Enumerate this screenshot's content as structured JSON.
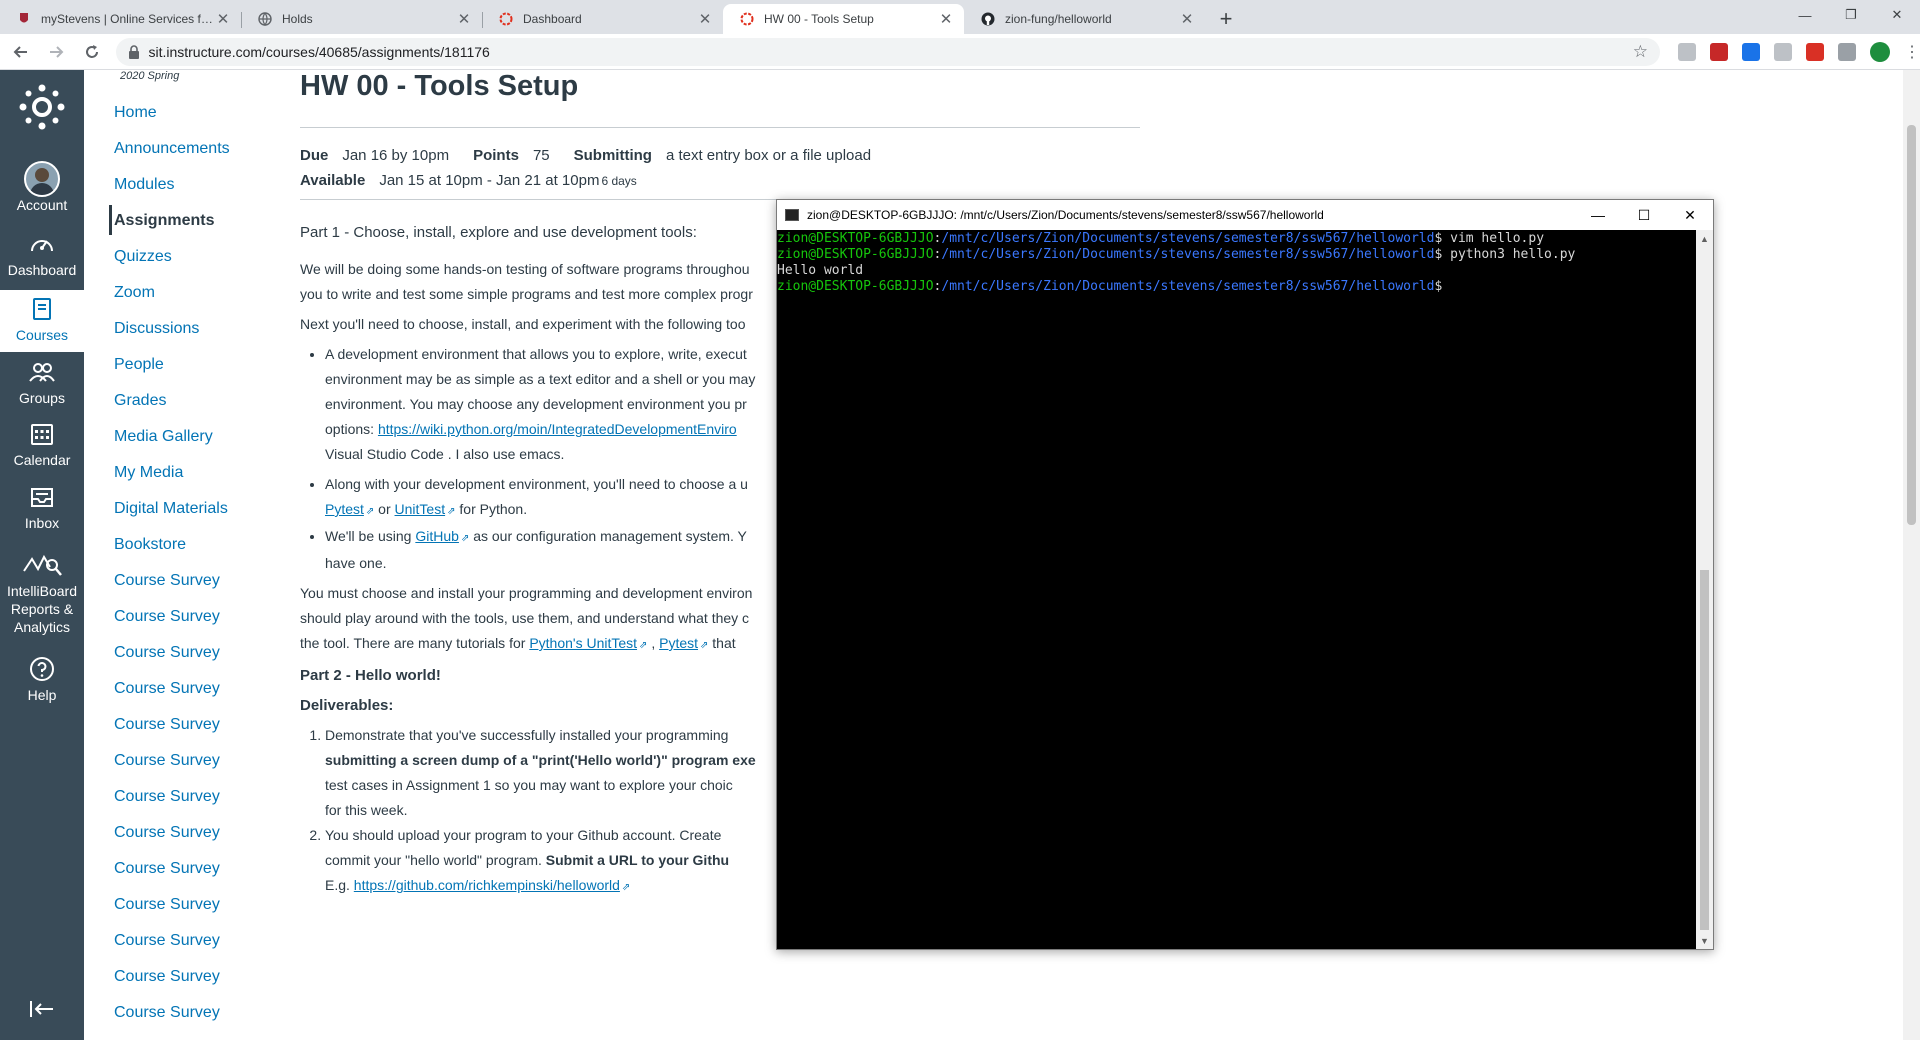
{
  "browser": {
    "tabs": [
      {
        "title": "myStevens | Online Services for the",
        "icon": "stevens-icon"
      },
      {
        "title": "Holds",
        "icon": "globe-icon"
      },
      {
        "title": "Dashboard",
        "icon": "canvas-icon"
      },
      {
        "title": "HW 00 - Tools Setup",
        "icon": "canvas-icon"
      },
      {
        "title": "zion-fung/helloworld",
        "icon": "github-icon"
      }
    ],
    "active_tab": 3,
    "url": "sit.instructure.com/courses/40685/assignments/181176"
  },
  "global_nav": [
    {
      "label": "Account",
      "icon": "avatar"
    },
    {
      "label": "Dashboard",
      "icon": "dashboard-icon"
    },
    {
      "label": "Courses",
      "icon": "courses-icon"
    },
    {
      "label": "Groups",
      "icon": "groups-icon"
    },
    {
      "label": "Calendar",
      "icon": "calendar-icon"
    },
    {
      "label": "Inbox",
      "icon": "inbox-icon"
    },
    {
      "label": "IntelliBoard Reports & Analytics",
      "icon": "analytics-icon"
    },
    {
      "label": "Help",
      "icon": "help-icon"
    }
  ],
  "course_nav": {
    "term": "2020 Spring",
    "items": [
      "Home",
      "Announcements",
      "Modules",
      "Assignments",
      "Quizzes",
      "Zoom",
      "Discussions",
      "People",
      "Grades",
      "Media Gallery",
      "My Media",
      "Digital Materials",
      "Bookstore",
      "Course Survey",
      "Course Survey",
      "Course Survey",
      "Course Survey",
      "Course Survey",
      "Course Survey",
      "Course Survey",
      "Course Survey",
      "Course Survey",
      "Course Survey",
      "Course Survey",
      "Course Survey",
      "Course Survey"
    ],
    "active": "Assignments"
  },
  "assignment": {
    "title": "HW 00 - Tools Setup",
    "due_label": "Due",
    "due": "Jan 16 by 10pm",
    "points_label": "Points",
    "points": "75",
    "submitting_label": "Submitting",
    "submitting": "a text entry box or a file upload",
    "available_label": "Available",
    "available": "Jan 15 at 10pm - Jan 21 at 10pm",
    "available_days": "6 days",
    "part1_bold": "Part 1",
    "part1_rest": " - Choose, install, explore and use development tools:",
    "para1a": "We will be doing some hands-on testing of software programs throughou",
    "para1b": "you to write and test some simple programs and test more complex progr",
    "para2": "Next you'll need to choose, install, and experiment with the following too",
    "b1_l1": "A development environment that allows you to explore, write, execut",
    "b1_l2": "environment may be as simple as a text editor and a shell or you may",
    "b1_l3": "environment.   You may choose any development environment you pr",
    "b1_l4_pre": "options:  ",
    "b1_l4_link": "https://wiki.python.org/moin/IntegratedDevelopmentEnviro",
    "b1_l5": "Visual Studio Code .  I also use emacs.",
    "b2_l1": "Along with your development environment, you'll need to choose a u",
    "b2_link1": "Pytest",
    "b2_or": " or ",
    "b2_link2": "UnitTest",
    "b2_tail": " for Python.",
    "b3_pre": "We'll be using ",
    "b3_link": "GitHub",
    "b3_tail": " as our configuration management system.   Y",
    "b3_l2": "have one.",
    "para3a": "You must choose and install your programming and development environ",
    "para3b": "should play around with the tools, use them, and understand what they c",
    "para3c_pre": "the tool.   There are many tutorials for ",
    "para3c_link1": "Python's UnitTest",
    "para3c_mid": " , ",
    "para3c_link2": "Pytest",
    "para3c_tail": "  that",
    "part2": "Part 2 - Hello world!",
    "deliverables": "Deliverables:",
    "d1_l1": "Demonstrate that you've successfully installed your programming",
    "d1_l2_bold": "submitting a screen dump of a \"print('Hello world')\" program exe",
    "d1_l3": "test cases in Assignment 1 so you may want to explore your choic",
    "d1_l4": "for this week.",
    "d2_l1": "You should upload your program to your Github account.    Create",
    "d2_l2_pre": "commit your \"hello world\" program.    ",
    "d2_l2_bold": "Submit a URL to your Githu",
    "d2_l3_pre": "E.g. ",
    "d2_l3_link": "https://github.com/richkempinski/helloworld"
  },
  "terminal": {
    "title": "zion@DESKTOP-6GBJJJO: /mnt/c/Users/Zion/Documents/stevens/semester8/ssw567/helloworld",
    "lines": [
      {
        "user": "zion@DESKTOP-6GBJJJO",
        "path": "/mnt/c/Users/Zion/Documents/stevens/semester8/ssw567/helloworld",
        "cmd": "$ vim hello.py"
      },
      {
        "user": "zion@DESKTOP-6GBJJJO",
        "path": "/mnt/c/Users/Zion/Documents/stevens/semester8/ssw567/helloworld",
        "cmd": "$ python3 hello.py"
      },
      {
        "output": "Hello world"
      },
      {
        "user": "zion@DESKTOP-6GBJJJO",
        "path": "/mnt/c/Users/Zion/Documents/stevens/semester8/ssw567/helloworld",
        "cmd": "$"
      }
    ]
  },
  "colors": {
    "canvas_nav": "#394b58",
    "link": "#0374b5",
    "text": "#2d3b45",
    "terminal_user": "#16c60c",
    "terminal_path": "#3b78ff"
  }
}
